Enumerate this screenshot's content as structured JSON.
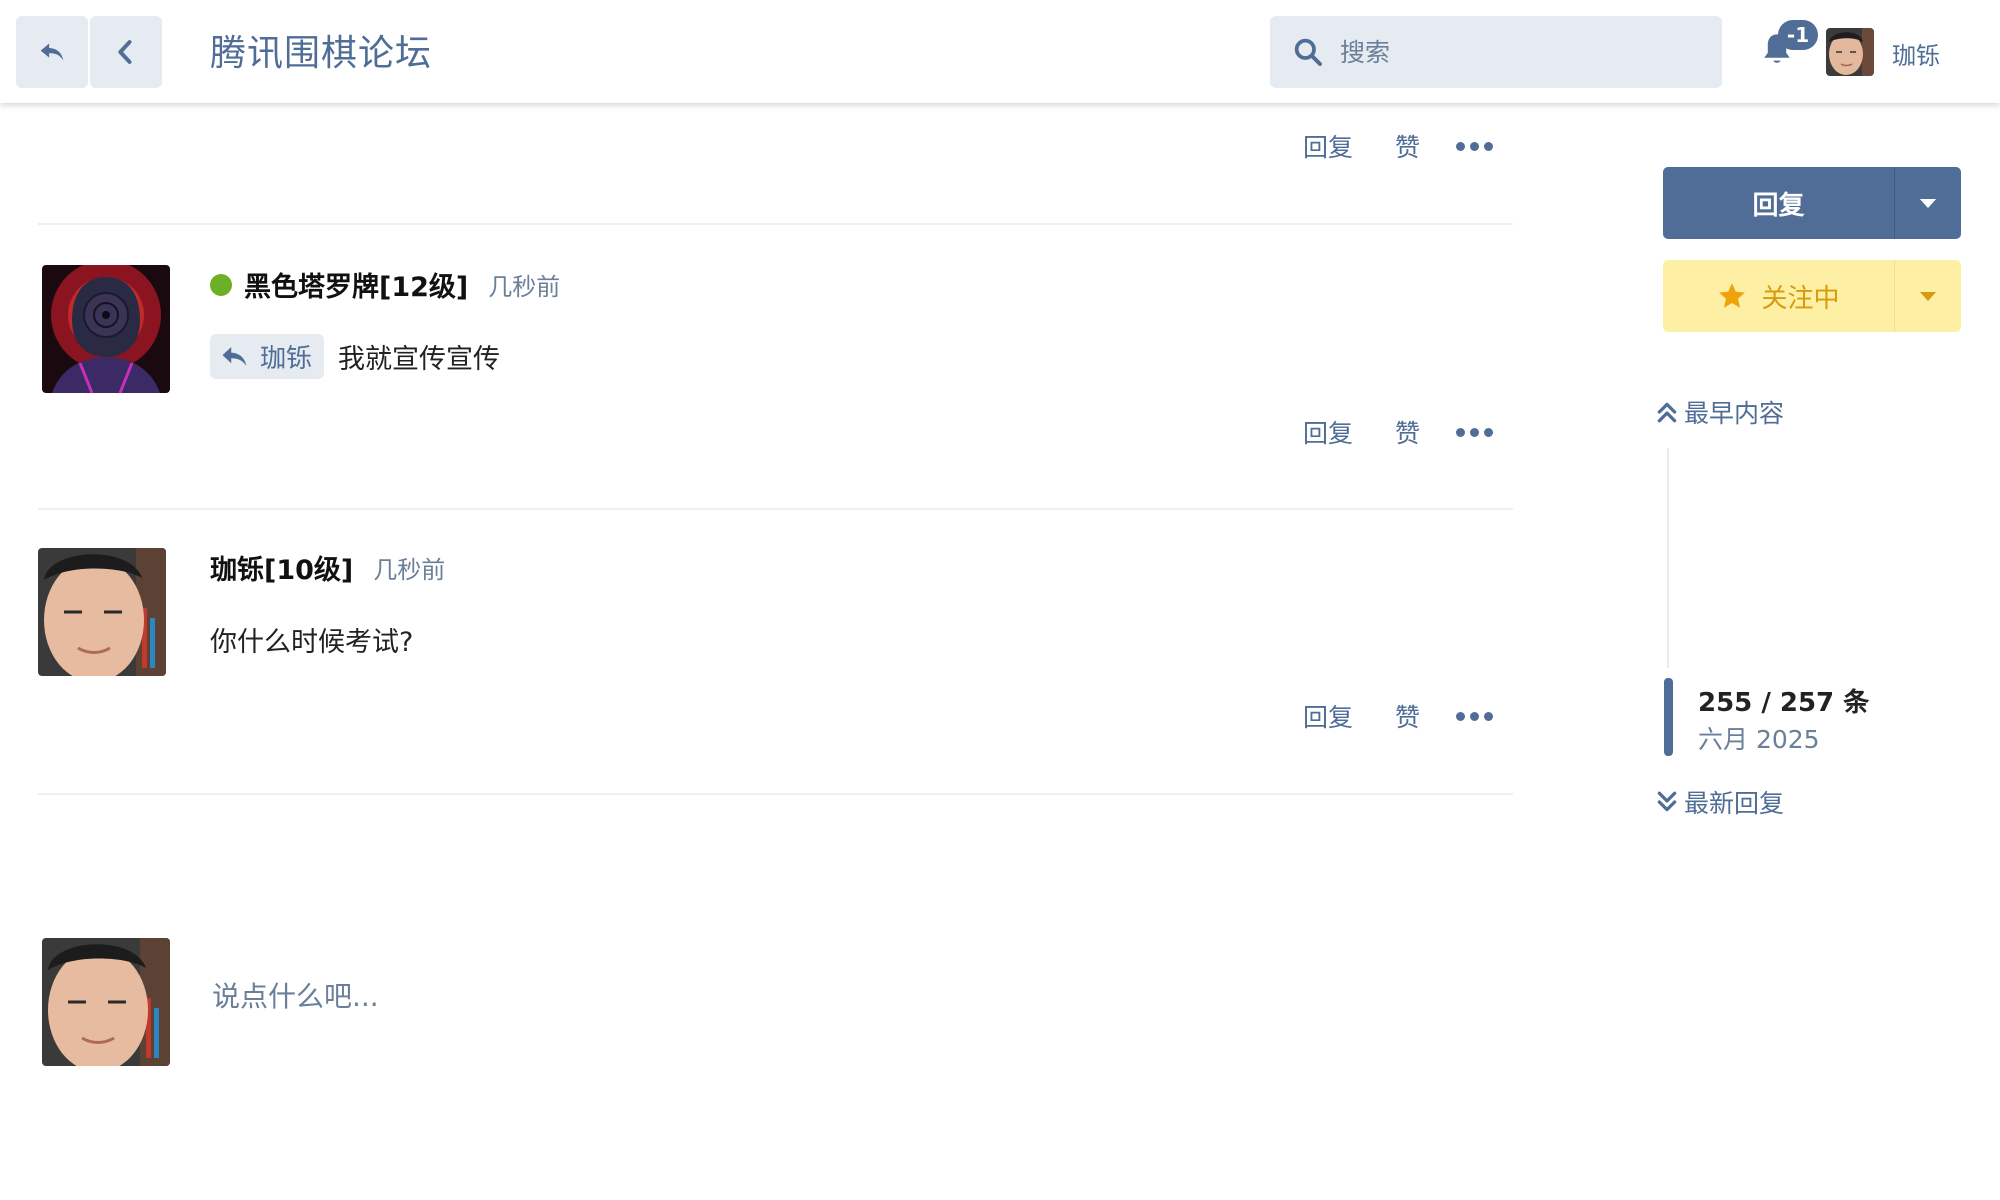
{
  "header": {
    "site_title": "腾讯围棋论坛",
    "search_placeholder": "搜索",
    "notification_badge": "-1",
    "username": "珈铄"
  },
  "posts": [
    {
      "partial": true,
      "actions": {
        "reply": "回复",
        "like": "赞"
      }
    },
    {
      "username": "黑色塔罗牌[12级]",
      "online": true,
      "time": "几秒前",
      "reply_to": "珈铄",
      "body": "我就宣传宣传",
      "actions": {
        "reply": "回复",
        "like": "赞"
      }
    },
    {
      "username": "珈铄[10级]",
      "online": false,
      "time": "几秒前",
      "body": "你什么时候考试?",
      "actions": {
        "reply": "回复",
        "like": "赞"
      }
    }
  ],
  "composer": {
    "placeholder": "说点什么吧..."
  },
  "sidebar": {
    "reply_button": "回复",
    "follow_button": "关注中",
    "earliest_link": "最早内容",
    "progress": "255 / 257 条",
    "progress_fraction": 0.992,
    "date": "六月 2025",
    "latest_link": "最新回复"
  },
  "colors": {
    "accent": "#4f6d96",
    "muted": "#6a7f99",
    "online": "#6bb026",
    "follow_bg": "#fdf0a4",
    "follow_text": "#d89a0d",
    "header_btn_bg": "#e6ebf2"
  },
  "icons": [
    "reply-arrow-icon",
    "back-chevron-icon",
    "search-icon",
    "bell-icon",
    "star-icon",
    "caret-down-icon",
    "chevrons-up-icon",
    "chevrons-down-icon",
    "more-dots-icon"
  ]
}
